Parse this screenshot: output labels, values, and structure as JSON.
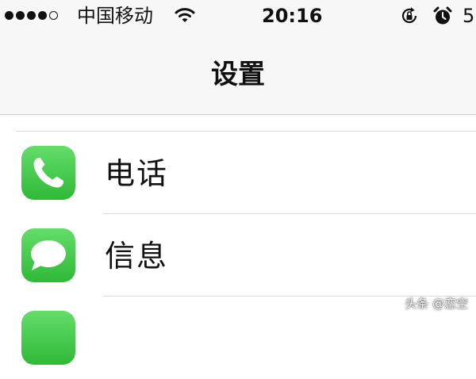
{
  "status_bar": {
    "signal_icon": "signal-dots-icon",
    "signal_level": 4,
    "signal_max": 5,
    "carrier": "中国移动",
    "wifi_icon": "wifi-icon",
    "time": "20:16",
    "rotation_lock_icon": "rotation-lock-icon",
    "alarm_icon": "alarm-clock-icon",
    "battery_text": "5"
  },
  "nav": {
    "title": "设置"
  },
  "settings": {
    "items": [
      {
        "label": "电话",
        "icon": "phone-icon",
        "icon_color": "#4cd964"
      },
      {
        "label": "信息",
        "icon": "messages-icon",
        "icon_color": "#4cd964"
      },
      {
        "label": "",
        "icon": "app-icon",
        "icon_color": "#4cd964"
      }
    ]
  },
  "watermark": "头条 @恋空"
}
